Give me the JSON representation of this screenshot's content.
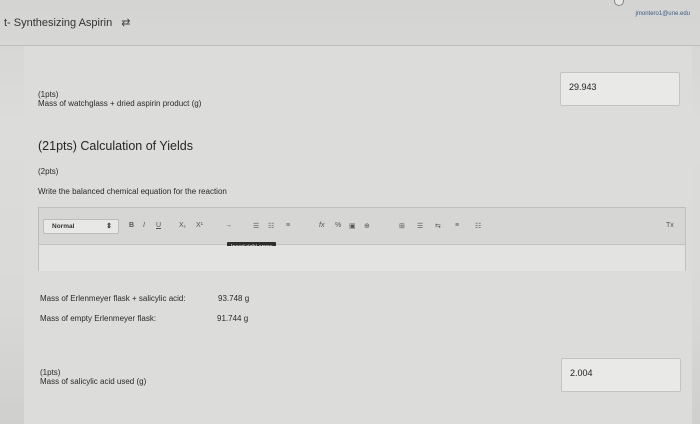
{
  "header": {
    "title": "t- Synthesizing Aspirin",
    "swap_icon": "⇄",
    "user_email": "jmontero1@une.edu"
  },
  "q1": {
    "points": "(1pts)",
    "label": "Mass of watchglass + dried aspirin product (g)",
    "value": "29.943"
  },
  "yields": {
    "heading": "(21pts) Calculation of Yields",
    "sub_points": "(2pts)",
    "instruction": "Write the balanced chemical equation for the reaction"
  },
  "editor": {
    "style_select": "Normal",
    "bold": "B",
    "italic": "I",
    "underline": "U",
    "subscript": "X₁",
    "superscript": "X¹",
    "arrow_tool": "→",
    "list_ordered": "☰",
    "list_unordered": "☷",
    "align": "≡",
    "formula": "fx",
    "percent": "%",
    "image": "▣",
    "link": "⊕",
    "table": "⊞",
    "rtl": "⇆",
    "clear_format": "Tx",
    "tooltip": "Insert right arrow"
  },
  "masses": {
    "flask_sal_label": "Mass of Erlenmeyer flask + salicylic acid:",
    "flask_sal_value": "93.748 g",
    "empty_flask_label": "Mass of empty Erlenmeyer flask:",
    "empty_flask_value": "91.744 g"
  },
  "q2": {
    "points": "(1pts)",
    "label": "Mass of salicylic acid used (g)",
    "value": "2.004"
  }
}
